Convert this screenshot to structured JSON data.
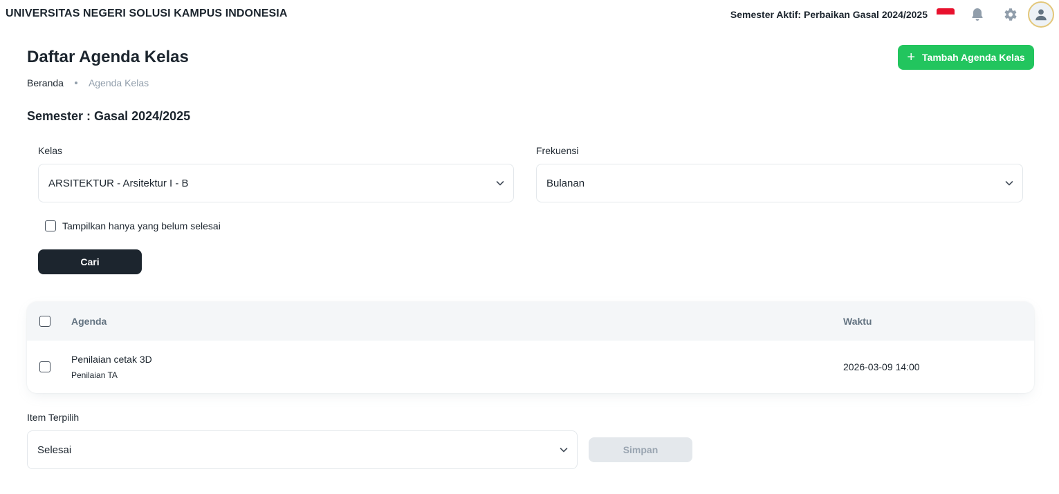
{
  "topbar": {
    "university_name": "UNIVERSITAS NEGERI SOLUSI KAMPUS INDONESIA",
    "active_semester": "Semester Aktif: Perbaikan Gasal 2024/2025",
    "icons": [
      "indonesia-flag-icon",
      "bell-icon",
      "gear-icon",
      "user-avatar-icon"
    ]
  },
  "header": {
    "title": "Daftar Agenda Kelas",
    "add_button_label": "Tambah Agenda Kelas",
    "breadcrumb": [
      "Beranda",
      "Agenda Kelas"
    ]
  },
  "semester_heading": "Semester : Gasal 2024/2025",
  "filters": {
    "kelas_label": "Kelas",
    "kelas_value": "ARSITEKTUR - Arsitektur I - B",
    "frekuensi_label": "Frekuensi",
    "frekuensi_value": "Bulanan",
    "unfinished_only_label": "Tampilkan hanya yang belum selesai",
    "unfinished_only_checked": false,
    "search_button_label": "Cari"
  },
  "table": {
    "columns": [
      "Agenda",
      "Waktu"
    ],
    "rows": [
      {
        "agenda": "Penilaian cetak 3D",
        "category": "Penilaian TA",
        "waktu": "2026-03-09 14:00",
        "checked": false
      }
    ]
  },
  "bulk_action": {
    "label": "Item Terpilih",
    "value": "Selesai",
    "save_button_label": "Simpan"
  },
  "colors": {
    "accent_green": "#22c55e",
    "dark_button": "#1c252e",
    "disabled_button": "#e4e8ec",
    "table_header_bg": "#f4f6f8"
  }
}
